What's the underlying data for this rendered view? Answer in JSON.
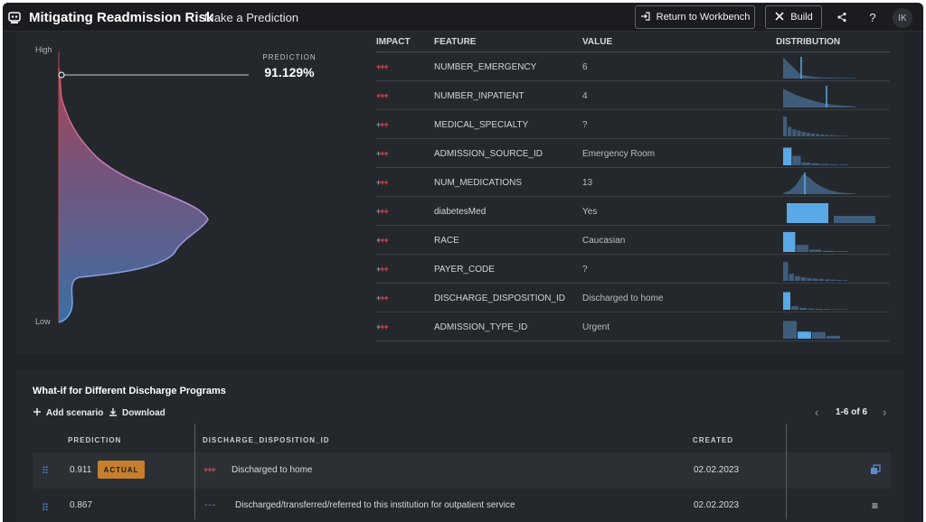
{
  "header": {
    "app_icon": "robot-icon",
    "title": "Mitigating Readmission Risk",
    "subtitle": "Make a Prediction",
    "return_label": "Return to Workbench",
    "return_icon": "sign-in-icon",
    "build_label": "Build",
    "build_icon": "tools-icon",
    "share_icon": "share-icon",
    "help_icon": "help-icon",
    "avatar_initials": "IK"
  },
  "prediction": {
    "label": "PREDICTION",
    "value": "91.129%",
    "value_fraction": 0.91129,
    "axis_high": "High",
    "axis_low": "Low"
  },
  "feature_table": {
    "headers": {
      "impact": "IMPACT",
      "feature": "FEATURE",
      "value": "VALUE",
      "distribution": "DISTRIBUTION"
    },
    "rows": [
      {
        "impact": "+++",
        "impact_strength": 3,
        "feature": "NUMBER_EMERGENCY",
        "value": "6"
      },
      {
        "impact": "+++",
        "impact_strength": 3,
        "feature": "NUMBER_INPATIENT",
        "value": "4"
      },
      {
        "impact": "+++",
        "impact_strength": 2,
        "feature": "MEDICAL_SPECIALTY",
        "value": "?"
      },
      {
        "impact": "+++",
        "impact_strength": 1,
        "feature": "ADMISSION_SOURCE_ID",
        "value": "Emergency Room"
      },
      {
        "impact": "+++",
        "impact_strength": 1,
        "feature": "NUM_MEDICATIONS",
        "value": "13"
      },
      {
        "impact": "+++",
        "impact_strength": 1,
        "feature": "diabetesMed",
        "value": "Yes"
      },
      {
        "impact": "+++",
        "impact_strength": 1,
        "feature": "RACE",
        "value": "Caucasian"
      },
      {
        "impact": "+++",
        "impact_strength": 1,
        "feature": "PAYER_CODE",
        "value": "?"
      },
      {
        "impact": "+++",
        "impact_strength": 1,
        "feature": "DISCHARGE_DISPOSITION_ID",
        "value": "Discharged to home"
      },
      {
        "impact": "+++",
        "impact_strength": 1,
        "feature": "ADMISSION_TYPE_ID",
        "value": "Urgent"
      }
    ]
  },
  "colors": {
    "impact_positive": "#e0474c",
    "impact_neutral": "#8a9099",
    "dist_fill": "#5aa9e6",
    "dist_dim": "#3f5d7a",
    "actual_badge": "#c77f2e",
    "accent_blue": "#5a8dd6"
  },
  "whatif": {
    "title": "What-if for Different Discharge Programs",
    "add_label": "Add scenario",
    "download_label": "Download",
    "pager": "1-6 of 6",
    "headers": {
      "prediction": "PREDICTION",
      "feature": "DISCHARGE_DISPOSITION_ID",
      "created": "CREATED"
    },
    "rows": [
      {
        "prediction": "0.911",
        "badge": "ACTUAL",
        "impact": "+++",
        "value": "Discharged to home",
        "created": "02.02.2023",
        "action_icon": "copy-icon"
      },
      {
        "prediction": "0.867",
        "badge": "",
        "impact": "---",
        "value": "Discharged/transferred/referred to this institution for outpatient service",
        "created": "02.02.2023",
        "action_icon": "menu-icon"
      }
    ]
  }
}
